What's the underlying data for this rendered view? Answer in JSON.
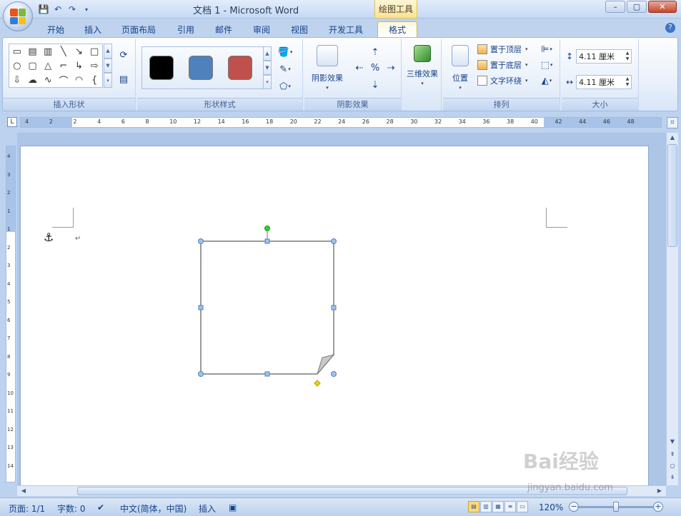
{
  "window": {
    "title": "文档 1 - Microsoft Word",
    "context_tab_title": "绘图工具",
    "controls": {
      "minimize": "–",
      "maximize": "▢",
      "close": "✕"
    }
  },
  "quick_access": [
    {
      "name": "save",
      "icon": "save-icon"
    },
    {
      "name": "undo",
      "icon": "undo-icon"
    },
    {
      "name": "redo",
      "icon": "redo-icon"
    },
    {
      "name": "customize",
      "icon": "chevron-down-icon"
    }
  ],
  "tabs": [
    {
      "label": "开始",
      "active": false
    },
    {
      "label": "插入",
      "active": false
    },
    {
      "label": "页面布局",
      "active": false
    },
    {
      "label": "引用",
      "active": false
    },
    {
      "label": "邮件",
      "active": false
    },
    {
      "label": "审阅",
      "active": false
    },
    {
      "label": "视图",
      "active": false
    },
    {
      "label": "开发工具",
      "active": false
    },
    {
      "label": "格式",
      "active": true
    }
  ],
  "ribbon": {
    "groups": {
      "insert_shapes": "插入形状",
      "shape_styles": "形状样式",
      "shadow_effects": "阴影效果",
      "three_d": "三维效果",
      "arrange": "排列",
      "size": "大小"
    },
    "shadow_button": "阴影效果",
    "three_d_button": "三维效果",
    "position_button": "位置",
    "bring_to_front": "置于顶层",
    "send_to_back": "置于底层",
    "text_wrapping": "文字环绕",
    "height_value": "4.11 厘米",
    "width_value": "4.11 厘米",
    "style_swatches": [
      "#000000",
      "#4f81bd",
      "#c0504d"
    ]
  },
  "ruler": {
    "h_labels": [
      "4",
      "2",
      "2",
      "4",
      "6",
      "8",
      "10",
      "12",
      "14",
      "16",
      "18",
      "20",
      "22",
      "24",
      "26",
      "28",
      "30",
      "32",
      "34",
      "36",
      "38",
      "40",
      "42",
      "44",
      "46",
      "48"
    ],
    "v_labels": [
      "4",
      "3",
      "2",
      "1",
      "1",
      "2",
      "3",
      "4",
      "5",
      "6",
      "7",
      "8",
      "9",
      "10",
      "11",
      "12",
      "13",
      "14"
    ]
  },
  "document": {
    "paragraph_mark": "↵",
    "anchor_symbol": "⚓"
  },
  "statusbar": {
    "page": "页面: 1/1",
    "words": "字数: 0",
    "language": "中文(简体，中国)",
    "mode": "插入",
    "zoom": "120%"
  },
  "watermark": {
    "brand": "Bai经验",
    "url": "jingyan.baidu.com"
  },
  "colors": {
    "selection_handle": "#4f81bd",
    "rotation_handle": "#33cc33",
    "adjust_handle": "#f5d300",
    "shape_outline": "#7a7a7a"
  }
}
